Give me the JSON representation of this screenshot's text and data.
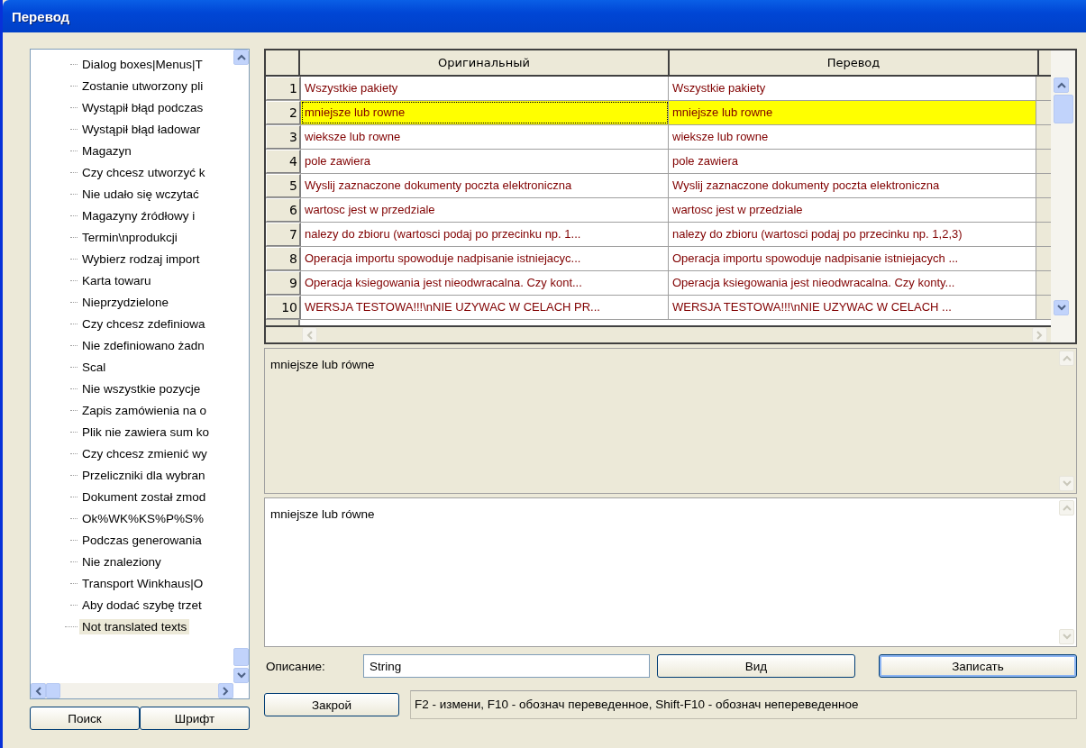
{
  "window": {
    "title": "Перевод"
  },
  "tree": {
    "items": [
      {
        "children": [
          {
            "label": "Dialog boxes|Menus|T",
            "selected": false
          },
          {
            "label": "Zostanie utworzony pli",
            "selected": false
          },
          {
            "label": "Wystąpił błąd podczas",
            "selected": false
          },
          {
            "label": "Wystąpił błąd ładowar",
            "selected": false
          },
          {
            "label": "Magazyn",
            "selected": false
          },
          {
            "label": "Czy chcesz utworzyć k",
            "selected": false
          },
          {
            "label": "Nie udało się wczytać",
            "selected": false
          },
          {
            "label": "Magazyny źródłowy i",
            "selected": false
          },
          {
            "label": "Termin\\nprodukcji",
            "selected": false
          },
          {
            "label": "Wybierz rodzaj import",
            "selected": false
          },
          {
            "label": "Karta towaru",
            "selected": false
          },
          {
            "label": "Nieprzydzielone",
            "selected": false
          },
          {
            "label": "Czy chcesz zdefiniowa",
            "selected": false
          },
          {
            "label": "Nie zdefiniowano żadn",
            "selected": false
          },
          {
            "label": "Scal",
            "selected": false
          },
          {
            "label": "Nie wszystkie pozycje",
            "selected": false
          },
          {
            "label": "Zapis zamówienia na o",
            "selected": false
          },
          {
            "label": "Plik nie zawiera sum ko",
            "selected": false
          },
          {
            "label": "Czy chcesz zmienić wy",
            "selected": false
          },
          {
            "label": "Przeliczniki dla wybran",
            "selected": false
          },
          {
            "label": "Dokument został zmod",
            "selected": false
          },
          {
            "label": "Ok%WK%KS%P%S%",
            "selected": false
          },
          {
            "label": "Podczas generowania",
            "selected": false
          },
          {
            "label": "Nie znaleziony",
            "selected": false
          },
          {
            "label": "Transport Winkhaus|O",
            "selected": false
          },
          {
            "label": "Aby dodać szybę trzet",
            "selected": false
          }
        ]
      },
      {
        "label": "Not translated texts",
        "selected": true
      }
    ]
  },
  "grid": {
    "columns": [
      "Оригинальный",
      "Перевод"
    ],
    "rows": [
      {
        "number": "1",
        "original": "Wszystkie pakiety",
        "translation": "Wszystkie pakiety",
        "selected": false
      },
      {
        "number": "2",
        "original": "mniejsze lub rowne",
        "translation": "mniejsze lub rowne",
        "selected": true
      },
      {
        "number": "3",
        "original": "wieksze lub rowne",
        "translation": "wieksze lub rowne",
        "selected": false
      },
      {
        "number": "4",
        "original": "pole zawiera",
        "translation": "pole zawiera",
        "selected": false
      },
      {
        "number": "5",
        "original": "Wyslij zaznaczone dokumenty poczta elektroniczna",
        "translation": "Wyslij zaznaczone dokumenty poczta elektroniczna",
        "selected": false
      },
      {
        "number": "6",
        "original": "wartosc jest w przedziale",
        "translation": "wartosc jest w przedziale",
        "selected": false
      },
      {
        "number": "7",
        "original": "nalezy do zbioru (wartosci podaj po przecinku np. 1...",
        "translation": "nalezy do zbioru (wartosci podaj po przecinku np. 1,2,3)",
        "selected": false
      },
      {
        "number": "8",
        "original": "Operacja importu spowoduje nadpisanie istniejacyc...",
        "translation": "Operacja importu spowoduje nadpisanie istniejacych ...",
        "selected": false
      },
      {
        "number": "9",
        "original": "Operacja ksiegowania jest nieodwracalna. Czy kont...",
        "translation": "Operacja ksiegowania jest nieodwracalna. Czy konty...",
        "selected": false
      },
      {
        "number": "10",
        "original": "WERSJA TESTOWA!!!\\nNIE UZYWAC W CELACH PR...",
        "translation": "WERSJA TESTOWA!!!\\nNIE UZYWAC W CELACH ...",
        "selected": false
      }
    ]
  },
  "original_text": {
    "value": "mniejsze lub równe"
  },
  "translation_text": {
    "value": "mniejsze lub równe"
  },
  "description": {
    "label": "Описание:",
    "value": "String"
  },
  "buttons": {
    "view": "Вид",
    "save": "Записать",
    "search": "Поиск",
    "font": "Шрифт",
    "close": "Закрой"
  },
  "status_bar": {
    "text": "F2 - измени, F10 - обознач переведенное, Shift-F10 - обознач непереведенное"
  }
}
